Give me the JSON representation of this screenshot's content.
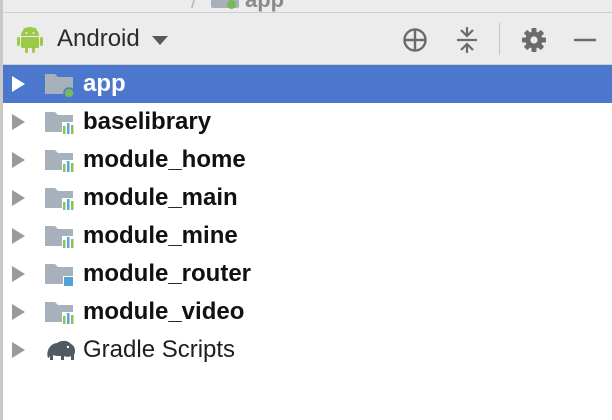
{
  "breadcrumb": {
    "project_fragment": "~~~~~~~~~~",
    "separator": "/",
    "current": "app"
  },
  "toolbar": {
    "view_mode": "Android",
    "buttons": [
      {
        "icon": "crosshair-icon",
        "action": "locate"
      },
      {
        "icon": "collapse-all-icon",
        "action": "collapse"
      },
      {
        "icon": "gear-icon",
        "action": "settings"
      },
      {
        "icon": "minimize-icon",
        "action": "hide"
      }
    ]
  },
  "tree": {
    "items": [
      {
        "label": "app",
        "icon": "app-module-icon",
        "bold": true,
        "selected": true
      },
      {
        "label": "baselibrary",
        "icon": "library-module-icon",
        "bold": true,
        "selected": false
      },
      {
        "label": "module_home",
        "icon": "library-module-icon",
        "bold": true,
        "selected": false
      },
      {
        "label": "module_main",
        "icon": "library-module-icon",
        "bold": true,
        "selected": false
      },
      {
        "label": "module_mine",
        "icon": "library-module-icon",
        "bold": true,
        "selected": false
      },
      {
        "label": "module_router",
        "icon": "java-module-icon",
        "bold": true,
        "selected": false
      },
      {
        "label": "module_video",
        "icon": "library-module-icon",
        "bold": true,
        "selected": false
      },
      {
        "label": "Gradle Scripts",
        "icon": "gradle-elephant-icon",
        "bold": false,
        "selected": false
      }
    ]
  },
  "colors": {
    "selection": "#4b77cd",
    "toolbar_bg": "#ececec",
    "android_green": "#9bc94a",
    "folder_gray": "#a7b1bb",
    "library_green": "#8fbf5a",
    "library_blue": "#5aa6d6",
    "app_dot": "#7ab85c"
  }
}
